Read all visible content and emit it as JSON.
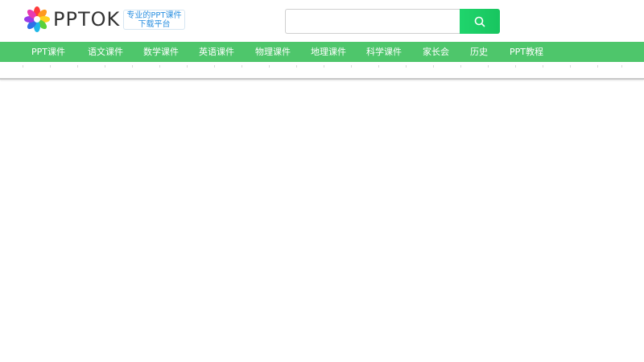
{
  "brand": {
    "logo_text": "PPTOK",
    "slogan_line1": "专业的PPT课件",
    "slogan_line2": "下载平台"
  },
  "search": {
    "value": "",
    "placeholder": "",
    "button_icon": "search-icon"
  },
  "nav": {
    "items": [
      {
        "label": "PPT课件"
      },
      {
        "label": "语文课件"
      },
      {
        "label": "数学课件"
      },
      {
        "label": "英语课件"
      },
      {
        "label": "物理课件"
      },
      {
        "label": "地理课件"
      },
      {
        "label": "科学课件"
      },
      {
        "label": "家长会"
      },
      {
        "label": "历史"
      },
      {
        "label": "PPT教程"
      }
    ]
  },
  "colors": {
    "nav_background": "#4ec66b",
    "search_button": "#1fd56c",
    "slogan_text": "#2a8fe0"
  }
}
